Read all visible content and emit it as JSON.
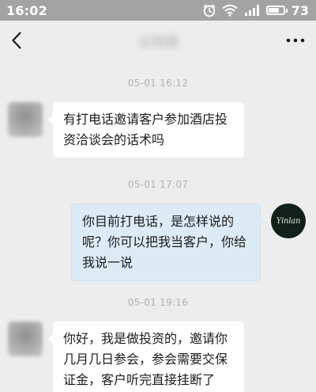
{
  "status_bar": {
    "time": "16:02",
    "battery": "73",
    "battery_level_percent": 73
  },
  "nav": {
    "contact_name": "公司测"
  },
  "messages": [
    {
      "type": "timestamp",
      "text": "05-01 16:12"
    },
    {
      "type": "incoming",
      "text": "有打电话邀请客户参加酒店投资洽谈会的话术吗"
    },
    {
      "type": "timestamp",
      "text": "05-01 17:07"
    },
    {
      "type": "outgoing",
      "text": "你目前打电话，是怎样说的呢？你可以把我当客户，你给我说一说",
      "avatar_text": "Yinlan"
    },
    {
      "type": "timestamp",
      "text": "05-01 19:16"
    },
    {
      "type": "incoming",
      "text": "你好，我是做投资的，邀请你几月几日参会，参会需要交保证金，客户听完直接挂断了"
    }
  ],
  "colors": {
    "status_bar_bg": "#a3a3a3",
    "chat_bg": "#ededed",
    "incoming_bubble": "#ffffff",
    "outgoing_bubble": "#dcebf6"
  }
}
